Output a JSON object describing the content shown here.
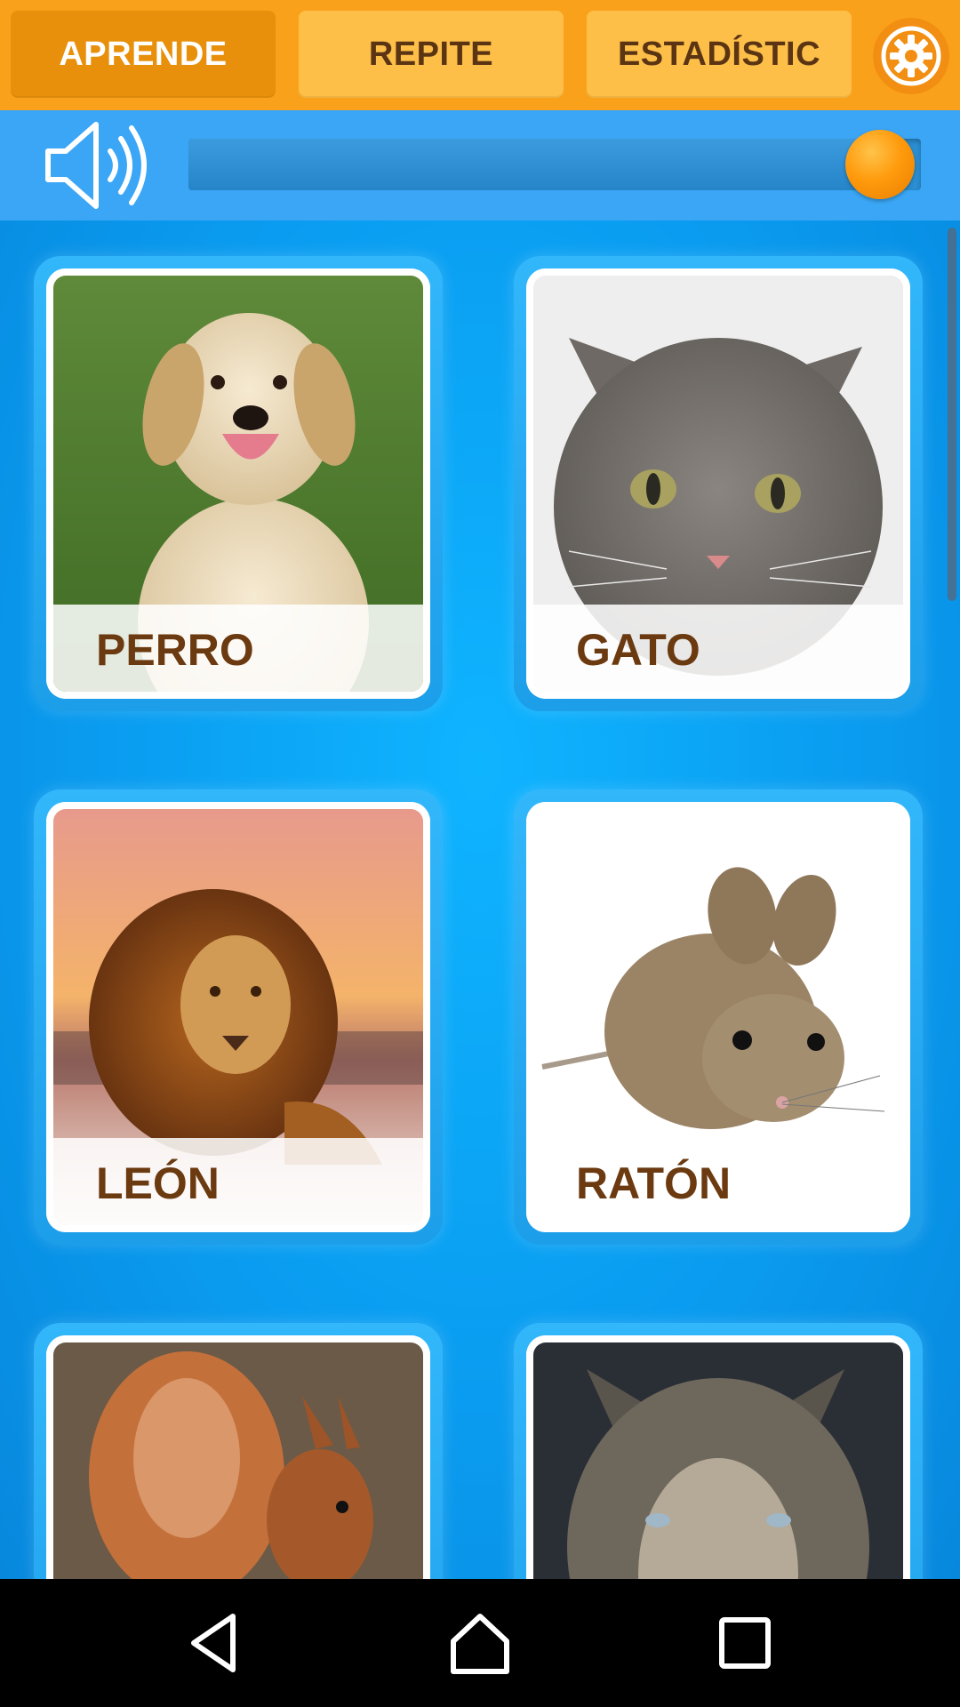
{
  "tabs": [
    {
      "label": "APRENDE",
      "active": true
    },
    {
      "label": "REPITE",
      "active": false
    },
    {
      "label": "ESTADÍSTIC",
      "active": false
    }
  ],
  "settings_icon": "gear-icon",
  "sound": {
    "icon": "speaker-icon",
    "volume_percent": 95
  },
  "cards": [
    {
      "label": "PERRO",
      "image": "golden retriever puppy on grass"
    },
    {
      "label": "GATO",
      "image": "grey tabby cat in snow"
    },
    {
      "label": "LEÓN",
      "image": "lion at sunset beach"
    },
    {
      "label": "RATÓN",
      "image": "mouse on white background"
    },
    {
      "label": "",
      "image": "red squirrel"
    },
    {
      "label": "",
      "image": "grey wolf"
    }
  ],
  "nav": [
    "back-icon",
    "home-icon",
    "recents-icon"
  ],
  "colors": {
    "topbar": "#f9a11b",
    "active_tab": "#e8900b",
    "tab": "#fdbf48",
    "soundbar": "#3aa6f5",
    "content": "#0b9ef2",
    "label_text": "#6b3a10",
    "knob": "#ff9b0d"
  }
}
